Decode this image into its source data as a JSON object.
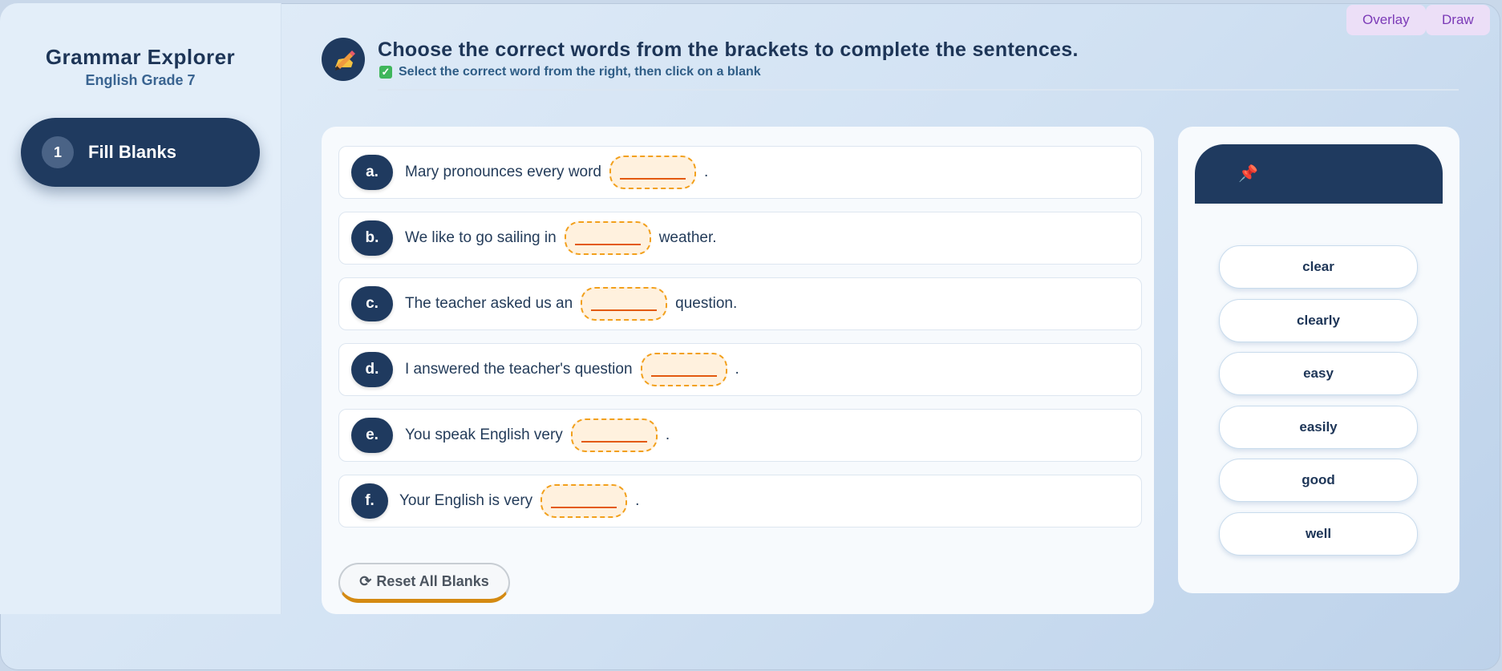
{
  "app": {
    "title": "Grammar Explorer",
    "subtitle": "English Grade 7"
  },
  "sidebar": {
    "items": [
      {
        "number": "1",
        "label": "Fill Blanks"
      }
    ]
  },
  "toolbar": {
    "overlay_label": "Overlay",
    "draw_label": "Draw"
  },
  "header": {
    "title": "Choose the correct words from the brackets to complete the sentences.",
    "instruction": "Select the correct word from the right, then click on a blank",
    "icon": "pencil-writing-icon"
  },
  "sentences": [
    {
      "letter": "a.",
      "before": "Mary pronounces every word",
      "after": "."
    },
    {
      "letter": "b.",
      "before": "We like to go sailing in",
      "after": "weather."
    },
    {
      "letter": "c.",
      "before": "The teacher asked us an",
      "after": "question."
    },
    {
      "letter": "d.",
      "before": "I answered the teacher's question",
      "after": "."
    },
    {
      "letter": "e.",
      "before": "You speak English very",
      "after": "."
    },
    {
      "letter": "f.",
      "before": "Your English is very",
      "after": "."
    }
  ],
  "reset_label": "Reset All Blanks",
  "word_bank": {
    "words": [
      "clear",
      "clearly",
      "easy",
      "easily",
      "good",
      "well"
    ]
  },
  "colors": {
    "navy": "#1f3a5f",
    "blank_border": "#f2a01c",
    "accent_purple": "#7b3ab7"
  }
}
